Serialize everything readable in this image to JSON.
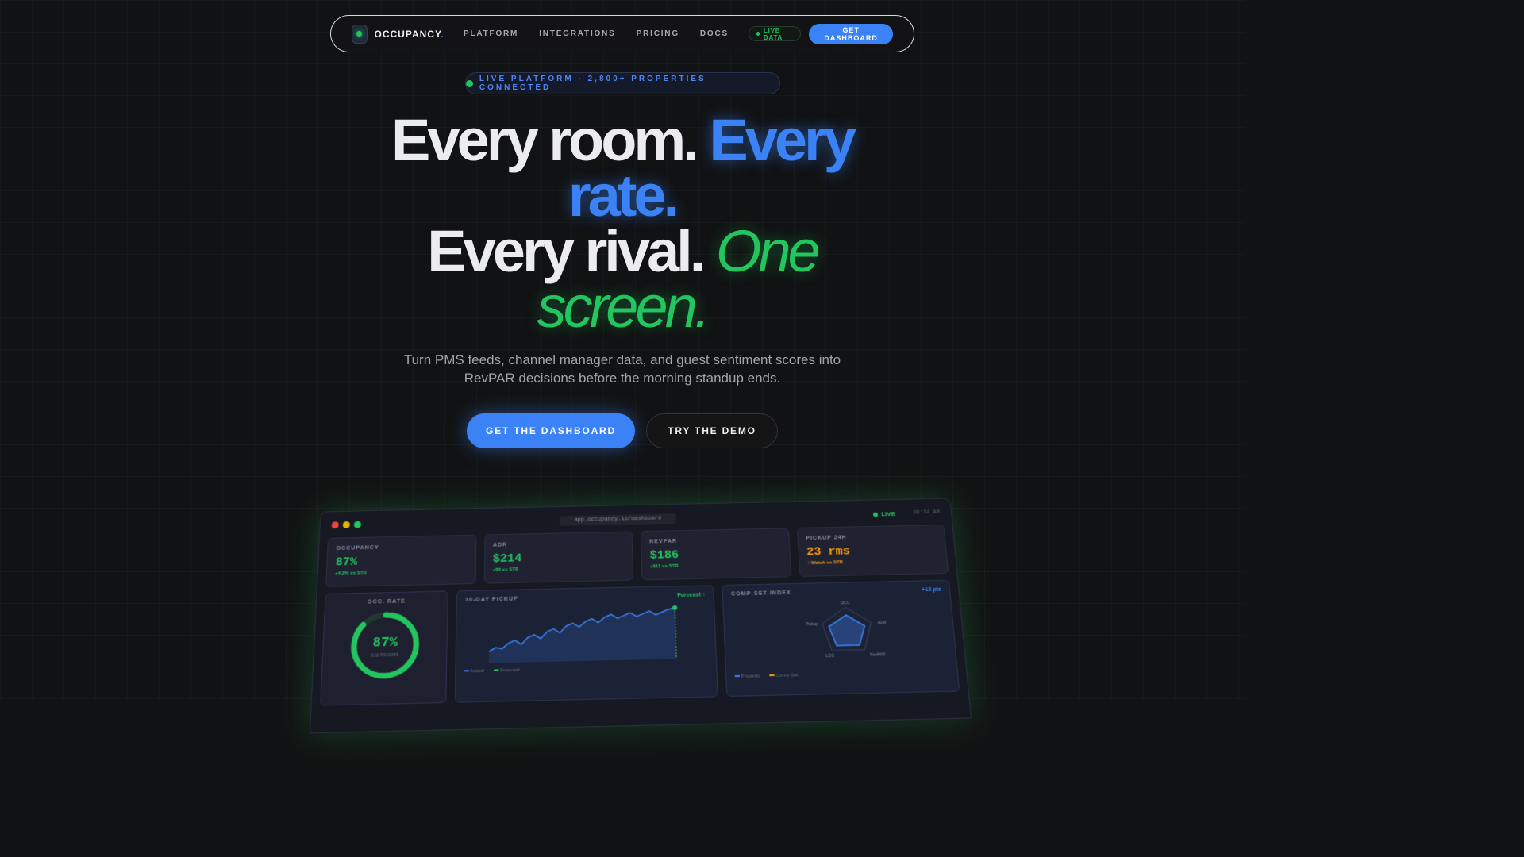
{
  "nav": {
    "brand": "OCCUPANCY",
    "brand_dot": ".",
    "links": [
      "PLATFORM",
      "INTEGRATIONS",
      "PRICING",
      "DOCS"
    ],
    "live_label": "LIVE DATA",
    "cta_label": "GET DASHBOARD"
  },
  "badge": {
    "text": "LIVE PLATFORM · 2,800+ PROPERTIES CONNECTED"
  },
  "hero": {
    "line1_white": "Every room.",
    "line1_blue": "Every",
    "line2_blue": "rate.",
    "line3_white": "Every rival.",
    "line3_green": "One",
    "line4_green": "screen."
  },
  "subtitle": {
    "line1": "Turn PMS feeds, channel manager data, and guest sentiment scores into",
    "line2": "RevPAR decisions before the morning standup ends."
  },
  "cta": {
    "primary": "GET THE DASHBOARD",
    "secondary": "TRY THE DEMO"
  },
  "dashboard": {
    "url": "app.occupancy.io/dashboard",
    "live_label": "LIVE",
    "time": "09:14 AM",
    "kpis": [
      {
        "label": "OCCUPANCY",
        "value": "87%",
        "delta": "+4.2% vs STR",
        "color": "#22c55e"
      },
      {
        "label": "ADR",
        "value": "$214",
        "delta": "+$8 vs STR",
        "color": "#22c55e"
      },
      {
        "label": "REVPAR",
        "value": "$186",
        "delta": "+$11 vs STR",
        "color": "#22c55e"
      },
      {
        "label": "PICKUP 24H",
        "value": "23 rms",
        "delta": "↑ Watch vs STR",
        "color": "#f59e0b"
      }
    ],
    "occ_panel": {
      "title": "OCC. RATE",
      "value": "87%",
      "sub": "212 ROOMS",
      "fraction": 0.87
    },
    "pickup_panel": {
      "title": "30-DAY PICKUP",
      "tag": "Forecast ↑",
      "legend": [
        "Actual",
        "Forecast"
      ],
      "values": [
        4,
        7,
        6,
        10,
        12,
        9,
        14,
        16,
        13,
        18,
        20,
        17,
        22,
        24,
        21,
        25,
        27,
        24,
        28,
        30,
        27,
        29,
        31,
        28,
        30,
        32,
        29,
        31,
        33,
        34
      ]
    },
    "compset_panel": {
      "title": "COMP-SET INDEX",
      "tag": "+13 pts",
      "axes": [
        "OCC",
        "ADR",
        "RevPAR",
        "LOS",
        "Pickup"
      ],
      "legend": [
        "Property",
        "Comp Set"
      ]
    }
  },
  "colors": {
    "accent_blue": "#3b82f6",
    "accent_green": "#22c55e",
    "accent_amber": "#f59e0b"
  }
}
